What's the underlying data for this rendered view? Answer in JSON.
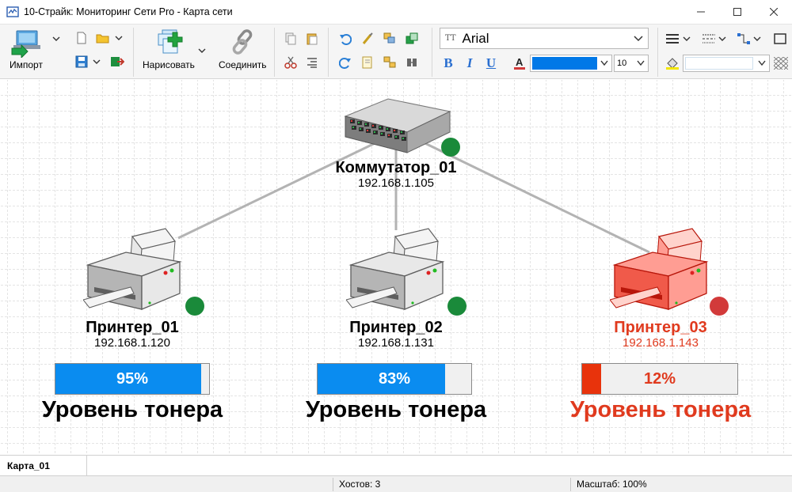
{
  "window": {
    "title": "10-Страйк: Мониторинг Сети Pro - Карта сети",
    "controls": [
      "minimize",
      "maximize",
      "close"
    ]
  },
  "toolbar": {
    "import_label": "Импорт",
    "draw_label": "Нарисовать",
    "connect_label": "Соединить",
    "font_name": "Arial",
    "font_size": "10",
    "text_color": "#0078e7",
    "icons": [
      "new-file-icon",
      "open-folder-icon",
      "save-icon",
      "export-icon",
      "copy-icon",
      "paste-icon",
      "cut-icon",
      "align-icon",
      "undo-icon",
      "redo-icon",
      "brush-icon",
      "edit-icon",
      "group-icon",
      "ungroup-icon",
      "bring-front-icon",
      "send-back-icon",
      "bold-icon",
      "italic-icon",
      "underline-icon",
      "font-color-icon",
      "line-style-icon",
      "dash-style-icon",
      "connector-icon",
      "rectangle-icon",
      "fill-icon",
      "pattern-icon"
    ]
  },
  "map": {
    "switch": {
      "name": "Коммутатор_01",
      "ip": "192.168.1.105",
      "status": "up",
      "status_color": "#1a8a3a"
    },
    "printers": [
      {
        "name": "Принтер_01",
        "ip": "192.168.1.120",
        "status": "up",
        "status_color": "#1a8a3a",
        "toner_level": 95,
        "toner_text": "95%",
        "toner_caption": "Уровень тонера",
        "bar_color": "#0a8cf0",
        "text_color": "#000000"
      },
      {
        "name": "Принтер_02",
        "ip": "192.168.1.131",
        "status": "up",
        "status_color": "#1a8a3a",
        "toner_level": 83,
        "toner_text": "83%",
        "toner_caption": "Уровень тонера",
        "bar_color": "#0a8cf0",
        "text_color": "#000000"
      },
      {
        "name": "Принтер_03",
        "ip": "192.168.1.143",
        "status": "down",
        "status_color": "#d23a3a",
        "toner_level": 12,
        "toner_text": "12%",
        "toner_caption": "Уровень тонера",
        "bar_color": "#e8330c",
        "text_color": "#e03a1e"
      }
    ]
  },
  "tabs": [
    {
      "label": "Карта_01"
    }
  ],
  "status": {
    "hosts": "Хостов: 3",
    "zoom": "Масштаб: 100%"
  }
}
